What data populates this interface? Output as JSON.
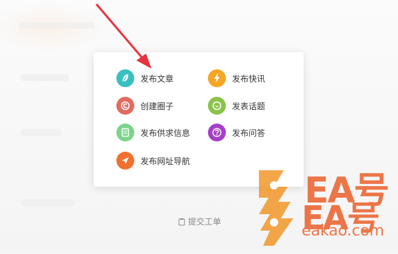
{
  "menu": {
    "items": [
      {
        "label": "发布文章",
        "icon": "feather-icon",
        "color": "#39bfc0"
      },
      {
        "label": "发布快讯",
        "icon": "lightning-icon",
        "color": "#f5a623"
      },
      {
        "label": "创建圈子",
        "icon": "circle-c-icon",
        "color": "#e26b5f"
      },
      {
        "label": "发表话题",
        "icon": "smile-icon",
        "color": "#8bc34a"
      },
      {
        "label": "发布供求信息",
        "icon": "document-icon",
        "color": "#7ed48a"
      },
      {
        "label": "发布问答",
        "icon": "question-icon",
        "color": "#a63fc9"
      },
      {
        "label": "发布网址导航",
        "icon": "send-icon",
        "color": "#f0712f"
      }
    ]
  },
  "footer": {
    "submit_ticket_label": "提交工单"
  },
  "watermark": {
    "brand_text_top": "EA号",
    "brand_text_bottom": "EA号",
    "domain": "eakao.com",
    "color": "#ea5a22"
  },
  "annotation": {
    "arrow_color": "#e8343d"
  }
}
